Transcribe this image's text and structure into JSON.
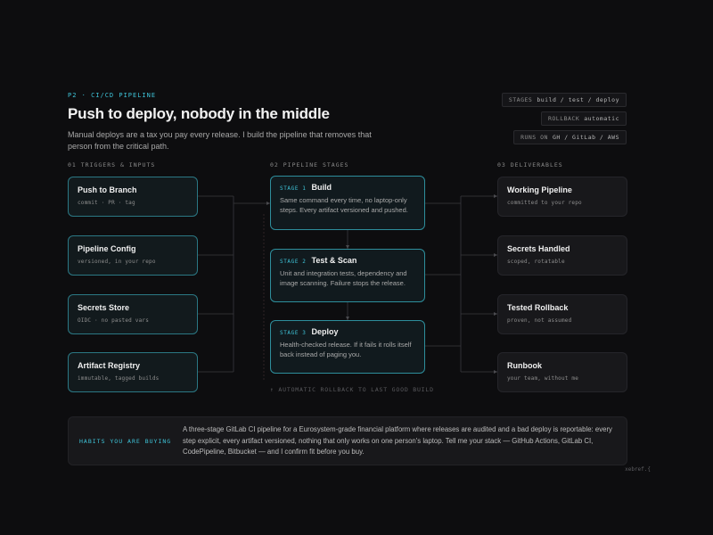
{
  "header": {
    "eyebrow": "P2 · CI/CD PIPELINE",
    "title": "Push to deploy, nobody in the middle",
    "subtitle": "Manual deploys are a tax you pay every release. I build the pipeline that removes that person from the critical path."
  },
  "meta": [
    {
      "key": "STAGES",
      "value": "build / test / deploy"
    },
    {
      "key": "ROLLBACK",
      "value": "automatic"
    },
    {
      "key": "RUNS ON",
      "value": "GH / GitLab / AWS"
    }
  ],
  "columns": {
    "inputs": "01  TRIGGERS & INPUTS",
    "stages": "02  PIPELINE STAGES",
    "outputs": "03  DELIVERABLES"
  },
  "inputs": [
    {
      "title": "Push to Branch",
      "sub": "commit · PR · tag"
    },
    {
      "title": "Pipeline Config",
      "sub": "versioned, in your repo"
    },
    {
      "title": "Secrets Store",
      "sub": "OIDC · no pasted vars"
    },
    {
      "title": "Artifact Registry",
      "sub": "immutable, tagged builds"
    }
  ],
  "stages": [
    {
      "num": "STAGE 1",
      "title": "Build",
      "desc": "Same command every time, no laptop-only steps. Every artifact versioned and pushed."
    },
    {
      "num": "STAGE 2",
      "title": "Test & Scan",
      "desc": "Unit and integration tests, dependency and image scanning. Failure stops the release."
    },
    {
      "num": "STAGE 3",
      "title": "Deploy",
      "desc": "Health-checked release. If it fails it rolls itself back instead of paging you."
    }
  ],
  "rollback_note": "↑  AUTOMATIC ROLLBACK TO LAST GOOD BUILD",
  "outputs": [
    {
      "title": "Working Pipeline",
      "sub": "committed to your repo"
    },
    {
      "title": "Secrets Handled",
      "sub": "scoped, rotatable"
    },
    {
      "title": "Tested Rollback",
      "sub": "proven, not assumed"
    },
    {
      "title": "Runbook",
      "sub": "your team, without me"
    }
  ],
  "footer": {
    "label": "HABITS YOU ARE BUYING",
    "text": "A three-stage GitLab CI pipeline for a Eurosystem-grade financial platform where releases are audited and a bad deploy is reportable: every step explicit, every artifact versioned, nothing that only works on one person's laptop. Tell me your stack — GitHub Actions, GitLab CI, CodePipeline, Bitbucket — and I confirm fit before you buy."
  },
  "signature": "xebref.{",
  "colors": {
    "accent": "#3ec3d8",
    "background": "#0d0d0f",
    "card_border": "#2b7884"
  }
}
